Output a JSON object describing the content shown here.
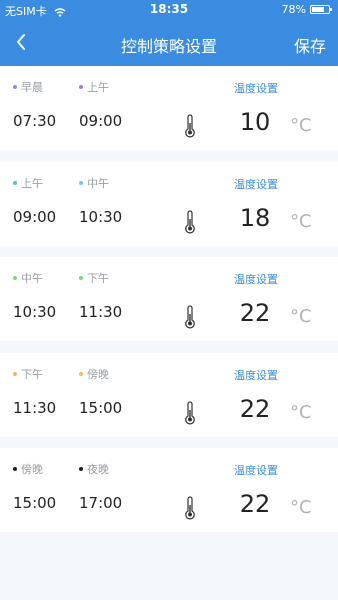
{
  "status_bar": {
    "carrier": "无SIM卡",
    "time": "18:35",
    "battery": "78%",
    "battery_level": 0.78
  },
  "nav": {
    "back_icon": "chevron-left-icon",
    "title": "控制策略设置",
    "save_label": "保存"
  },
  "colors": {
    "accent": "#3a8ce0"
  },
  "schedules": [
    {
      "start_label": "早晨",
      "start_time": "07:30",
      "start_color": "#8c8ce8",
      "end_label": "上午",
      "end_time": "09:00",
      "end_color": "#a080e0",
      "temp_link": "温度设置",
      "temperature": "10",
      "unit": "°C"
    },
    {
      "start_label": "上午",
      "start_time": "09:00",
      "start_color": "#4ec9c2",
      "end_label": "中午",
      "end_time": "10:30",
      "end_color": "#6cd0d0",
      "temp_link": "温度设置",
      "temperature": "18",
      "unit": "°C"
    },
    {
      "start_label": "中午",
      "start_time": "10:30",
      "start_color": "#7fd486",
      "end_label": "下午",
      "end_time": "11:30",
      "end_color": "#80d480",
      "temp_link": "温度设置",
      "temperature": "22",
      "unit": "°C"
    },
    {
      "start_label": "下午",
      "start_time": "11:30",
      "start_color": "#f0b45a",
      "end_label": "傍晚",
      "end_time": "15:00",
      "end_color": "#f0c060",
      "temp_link": "温度设置",
      "temperature": "22",
      "unit": "°C"
    },
    {
      "start_label": "傍晚",
      "start_time": "15:00",
      "start_color": "#222222",
      "end_label": "夜晚",
      "end_time": "17:00",
      "end_color": "#222222",
      "temp_link": "温度设置",
      "temperature": "22",
      "unit": "°C"
    }
  ]
}
